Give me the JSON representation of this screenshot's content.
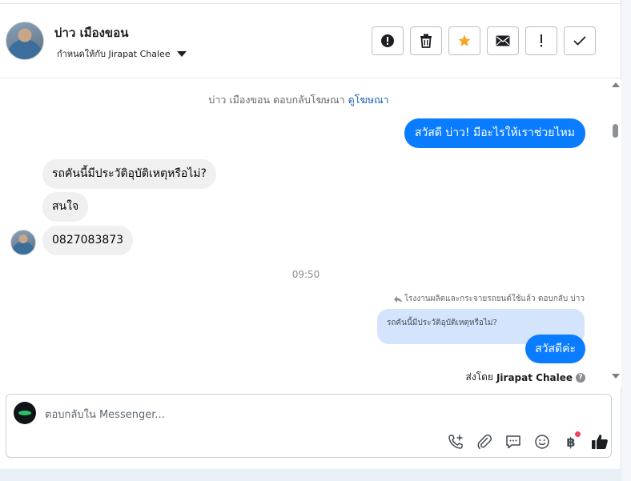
{
  "header": {
    "contact_name": "บ่าว เมืองขอน",
    "assigned_to": "กำหนดให้กับ Jirapat Chalee",
    "actions": [
      {
        "icon": "alert-circle-icon",
        "name": "mark-spam-button"
      },
      {
        "icon": "trash-icon",
        "name": "delete-button"
      },
      {
        "icon": "star-icon",
        "name": "star-button",
        "color": "#f5a623"
      },
      {
        "icon": "envelope-icon",
        "name": "mark-unread-button"
      },
      {
        "icon": "exclamation-icon",
        "name": "follow-up-button"
      },
      {
        "icon": "check-icon",
        "name": "mark-done-button"
      }
    ]
  },
  "thread": {
    "ad_notice": "บ่าว เมืองขอน ตอบกลับโฆษณา",
    "ad_link": "ดูโฆษณา",
    "outgoing_greeting": "สวัสดี บ่าว! มีอะไรให้เราช่วยไหม",
    "incoming": [
      "รถคันนี้มีประวัติอุบัติเหตุหรือไม่?",
      "สนใจ",
      "0827083873"
    ],
    "timestamp": "09:50",
    "reply_meta": "โรงงานผลิตและกระจายรถยนต์ใช้แล้ว ตอบกลับ บ่าว",
    "quoted_text": "รถคันนี้มีประวัติอุบัติเหตุหรือไม่?",
    "reply_text": "สวัสดีค่ะ",
    "sent_by_label": "ส่งโดย",
    "sent_by_name": "Jirapat Chalee"
  },
  "composer": {
    "placeholder": "ตอบกลับใน Messenger...",
    "tools": [
      "call-add-icon",
      "paperclip-icon",
      "chat-bubble-icon",
      "emoji-icon",
      "baht-icon",
      "thumbs-up-icon"
    ],
    "baht_symbol": "฿"
  },
  "colors": {
    "accent": "#0a7cff",
    "incoming_bubble": "#f0f0f0",
    "quoted_bubble": "#d3e4fc",
    "star": "#f5a623",
    "notification_dot": "#f3425f"
  }
}
